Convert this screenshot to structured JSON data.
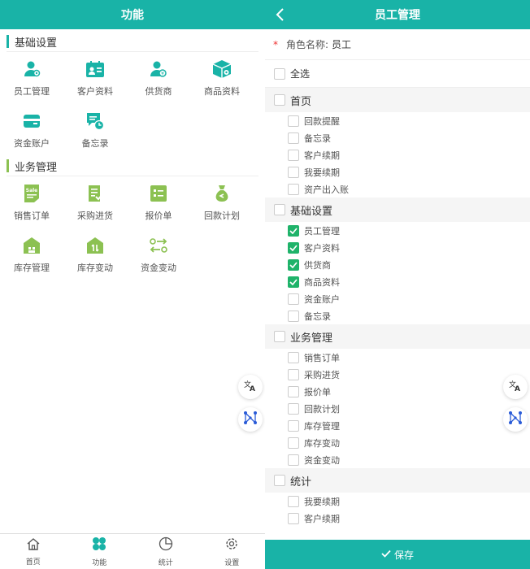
{
  "colors": {
    "primary": "#19b3a7",
    "checked": "#1fb36a",
    "required": "#e33"
  },
  "left": {
    "title": "功能",
    "sections": [
      {
        "title": "基础设置",
        "items": [
          {
            "label": "员工管理",
            "icon": "employee-icon"
          },
          {
            "label": "客户资料",
            "icon": "customer-card-icon"
          },
          {
            "label": "供货商",
            "icon": "supplier-icon"
          },
          {
            "label": "商品资料",
            "icon": "product-box-icon"
          },
          {
            "label": "资金账户",
            "icon": "wallet-icon"
          },
          {
            "label": "备忘录",
            "icon": "memo-icon"
          }
        ]
      },
      {
        "title": "业务管理",
        "items": [
          {
            "label": "销售订单",
            "icon": "sale-icon"
          },
          {
            "label": "采购进货",
            "icon": "purchase-icon"
          },
          {
            "label": "报价单",
            "icon": "quote-icon"
          },
          {
            "label": "回款计划",
            "icon": "money-bag-icon"
          },
          {
            "label": "库存管理",
            "icon": "warehouse-icon"
          },
          {
            "label": "库存变动",
            "icon": "stock-change-icon"
          },
          {
            "label": "资金变动",
            "icon": "fund-change-icon"
          }
        ]
      }
    ],
    "tabs": [
      {
        "label": "首页",
        "icon": "home-icon"
      },
      {
        "label": "功能",
        "icon": "clover-icon"
      },
      {
        "label": "统计",
        "icon": "pie-chart-icon"
      },
      {
        "label": "设置",
        "icon": "gear-icon"
      }
    ]
  },
  "right": {
    "title": "员工管理",
    "role_label": "角色名称:",
    "role_value": "员工",
    "required_mark": "*",
    "select_all": "全选",
    "groups": [
      {
        "title": "首页",
        "checked": false,
        "items": [
          {
            "label": "回款提醒",
            "checked": false
          },
          {
            "label": "备忘录",
            "checked": false
          },
          {
            "label": "客户续期",
            "checked": false
          },
          {
            "label": "我要续期",
            "checked": false
          },
          {
            "label": "资产出入账",
            "checked": false
          }
        ]
      },
      {
        "title": "基础设置",
        "checked": false,
        "items": [
          {
            "label": "员工管理",
            "checked": true
          },
          {
            "label": "客户资料",
            "checked": true
          },
          {
            "label": "供货商",
            "checked": true
          },
          {
            "label": "商品资料",
            "checked": true
          },
          {
            "label": "资金账户",
            "checked": false
          },
          {
            "label": "备忘录",
            "checked": false
          }
        ]
      },
      {
        "title": "业务管理",
        "checked": false,
        "items": [
          {
            "label": "销售订单",
            "checked": false
          },
          {
            "label": "采购进货",
            "checked": false
          },
          {
            "label": "报价单",
            "checked": false
          },
          {
            "label": "回款计划",
            "checked": false
          },
          {
            "label": "库存管理",
            "checked": false
          },
          {
            "label": "库存变动",
            "checked": false
          },
          {
            "label": "资金变动",
            "checked": false
          }
        ]
      },
      {
        "title": "统计",
        "checked": false,
        "items": [
          {
            "label": "我要续期",
            "checked": false
          },
          {
            "label": "客户续期",
            "checked": false
          }
        ]
      }
    ],
    "save_label": "保存"
  }
}
